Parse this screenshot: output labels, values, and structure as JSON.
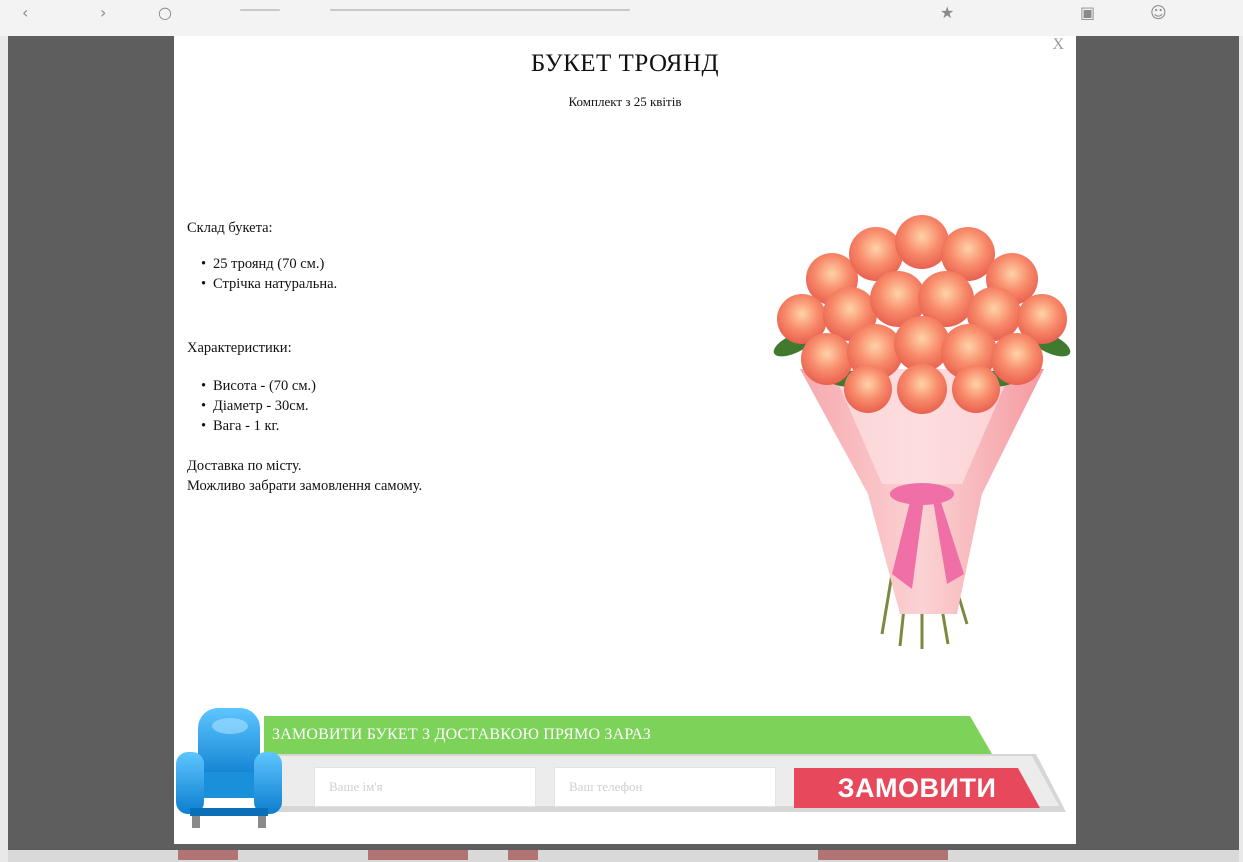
{
  "modal": {
    "close_label": "X",
    "title": "БУКЕТ ТРОЯНД",
    "subtitle": "Комплект з 25 квітів",
    "composition": {
      "heading": "Склад букета:",
      "items": [
        "25 троянд (70 см.)",
        "Стрічка натуральна."
      ]
    },
    "characteristics": {
      "heading": "Характеристики:",
      "items": [
        "Висота - (70 см.)",
        "Діаметр - 30см.",
        "Вага - 1 кг."
      ]
    },
    "delivery": {
      "line1": "Доставка по місту.",
      "line2": "Можливо забрати замовлення самому."
    }
  },
  "order_form": {
    "banner_text": "ЗАМОВИТИ БУКЕТ З ДОСТАВКОЮ ПРЯМО ЗАРАЗ",
    "name_placeholder": "Ваше ім'я",
    "phone_placeholder": "Ваш телефон",
    "submit_label": "ЗАМОВИТИ"
  },
  "colors": {
    "overlay": "#5e5e5e",
    "banner_green": "#7dd25a",
    "submit_red": "#e8485b",
    "chair_blue": "#1f9be3",
    "ribbon_pink": "#ef6fa6",
    "rose_coral": "#f47a62"
  }
}
